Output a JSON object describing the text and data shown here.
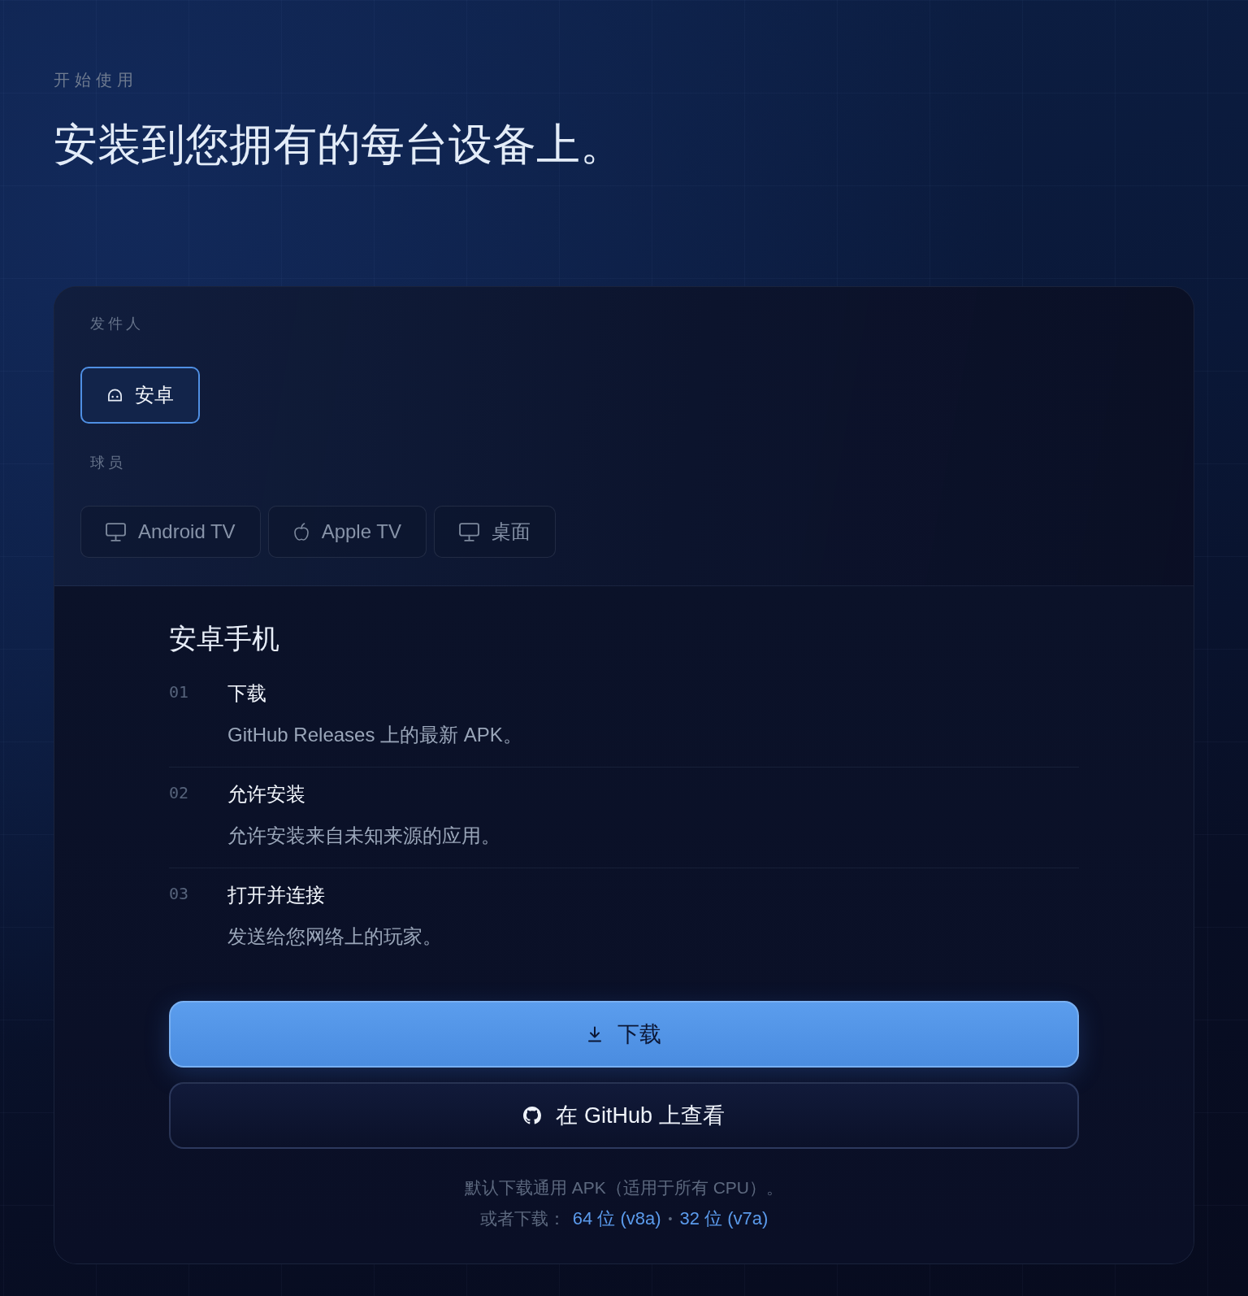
{
  "eyebrow": "开始使用",
  "title": "安装到您拥有的每台设备上。",
  "panel": {
    "groups": [
      {
        "label": "发件人",
        "options": [
          {
            "label": "安卓",
            "kind": "phone",
            "selected": true
          }
        ]
      },
      {
        "label": "球员",
        "options": [
          {
            "label": "Android TV",
            "kind": "tv",
            "selected": false
          },
          {
            "label": "Apple TV",
            "kind": "appletv",
            "selected": false
          },
          {
            "label": "桌面",
            "kind": "desktop",
            "selected": false
          }
        ]
      }
    ],
    "guide": {
      "heading": "安卓手机",
      "steps": [
        {
          "number": "01",
          "title": "下载",
          "description": "GitHub Releases 上的最新 APK。"
        },
        {
          "number": "02",
          "title": "允许安装",
          "description": "允许安装来自未知来源的应用。"
        },
        {
          "number": "03",
          "title": "打开并连接",
          "description": "发送给您网络上的玩家。"
        }
      ],
      "buttons": [
        {
          "kind": "primary",
          "label": "下载"
        },
        {
          "kind": "secondary",
          "label": "在 GitHub 上查看"
        }
      ],
      "note": "默认下载通用 APK（适用于所有 CPU）。",
      "alternatives": {
        "prefix": "或者下载：",
        "links": [
          "64 位 (v8a)",
          "32 位 (v7a)"
        ],
        "separator": "•"
      }
    }
  }
}
